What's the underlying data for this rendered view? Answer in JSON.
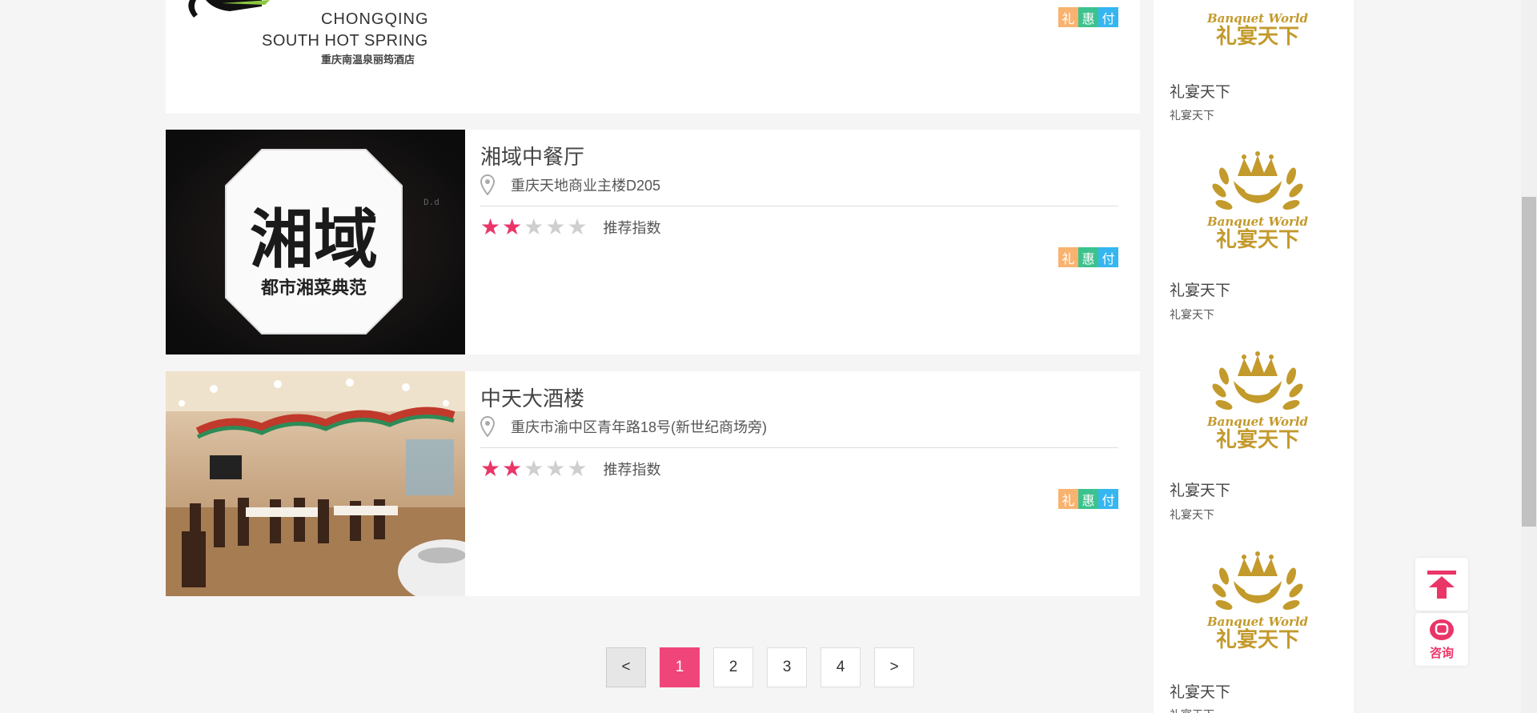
{
  "top_card": {
    "logo_line1": "CHONGQING",
    "logo_line2": "SOUTH HOT SPRING",
    "logo_line3": "重庆南温泉丽筠酒店"
  },
  "tags": [
    "礼",
    "惠",
    "付"
  ],
  "tag_colors": [
    "#f8b370",
    "#3cc28e",
    "#35b6f1"
  ],
  "restaurants": [
    {
      "name": "湘域中餐厅",
      "address": "重庆天地商业主楼D205",
      "stars": 2,
      "max_stars": 5,
      "rating_label": "推荐指数",
      "photo_title": "湘域",
      "photo_subtitle": "都市湘菜典范"
    },
    {
      "name": "中天大酒楼",
      "address": "重庆市渝中区青年路18号(新世纪商场旁)",
      "stars": 2,
      "max_stars": 5,
      "rating_label": "推荐指数"
    }
  ],
  "pagination": {
    "prev": "<",
    "pages": [
      "1",
      "2",
      "3",
      "4"
    ],
    "current": "1",
    "next": ">"
  },
  "sidebar": {
    "items": [
      {
        "title": "礼宴天下",
        "subtitle": "礼宴天下",
        "logo_text": "Banquet World",
        "logo_cn": "礼宴天下"
      },
      {
        "title": "礼宴天下",
        "subtitle": "礼宴天下",
        "logo_text": "Banquet World",
        "logo_cn": "礼宴天下"
      },
      {
        "title": "礼宴天下",
        "subtitle": "礼宴天下",
        "logo_text": "Banquet World",
        "logo_cn": "礼宴天下"
      },
      {
        "title": "礼宴天下",
        "subtitle": "礼宴天下",
        "logo_text": "Banquet World",
        "logo_cn": "礼宴天下"
      }
    ]
  },
  "float_buttons": {
    "back_to_top_icon": "arrow-up-to-line-icon",
    "consult_icon": "chat-bubble-icon",
    "consult_label": "咨询"
  },
  "colors": {
    "accent": "#ea3568",
    "page_active": "#f0457a",
    "logo_gold": "#c39a2c"
  }
}
